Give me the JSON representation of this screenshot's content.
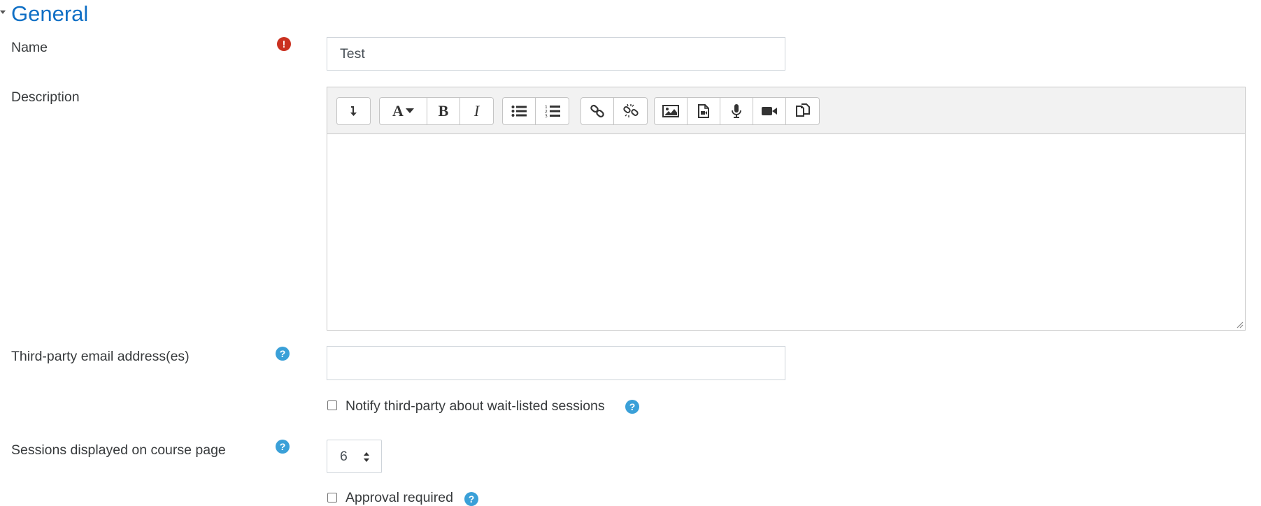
{
  "section": {
    "title": "General"
  },
  "fields": {
    "name": {
      "label": "Name",
      "value": "Test",
      "required_icon": "exclamation-icon"
    },
    "description": {
      "label": "Description",
      "toolbar": [
        {
          "group": "toggle",
          "buttons": [
            {
              "name": "show-more-buttons",
              "icon": "arrow-down-turn-icon"
            }
          ]
        },
        {
          "group": "style",
          "buttons": [
            {
              "name": "paragraph-styles",
              "icon": "font-icon"
            },
            {
              "name": "bold",
              "icon": "bold-icon"
            },
            {
              "name": "italic",
              "icon": "italic-icon"
            }
          ]
        },
        {
          "group": "lists",
          "buttons": [
            {
              "name": "unordered-list",
              "icon": "list-ul-icon"
            },
            {
              "name": "ordered-list",
              "icon": "list-ol-icon"
            }
          ]
        },
        {
          "group": "links",
          "buttons": [
            {
              "name": "link",
              "icon": "link-icon"
            },
            {
              "name": "unlink",
              "icon": "unlink-icon"
            }
          ]
        },
        {
          "group": "files",
          "buttons": [
            {
              "name": "insert-image",
              "icon": "image-icon"
            },
            {
              "name": "insert-media",
              "icon": "file-video-icon"
            },
            {
              "name": "record-audio",
              "icon": "microphone-icon"
            },
            {
              "name": "record-video",
              "icon": "video-camera-icon"
            },
            {
              "name": "manage-files",
              "icon": "copy-files-icon"
            }
          ]
        }
      ]
    },
    "third_party": {
      "label": "Third-party email address(es)",
      "value": "",
      "help_icon": "question-icon"
    },
    "notify_waitlist": {
      "label": "Notify third-party about wait-listed sessions",
      "checked": false,
      "help_icon": "question-icon"
    },
    "sessions_displayed": {
      "label": "Sessions displayed on course page",
      "value": "6",
      "help_icon": "question-icon"
    },
    "approval_required": {
      "label": "Approval required",
      "checked": false,
      "help_icon": "question-icon"
    }
  },
  "colors": {
    "heading": "#0f6fc5",
    "error": "#ca3120",
    "help": "#3aa0d8"
  }
}
